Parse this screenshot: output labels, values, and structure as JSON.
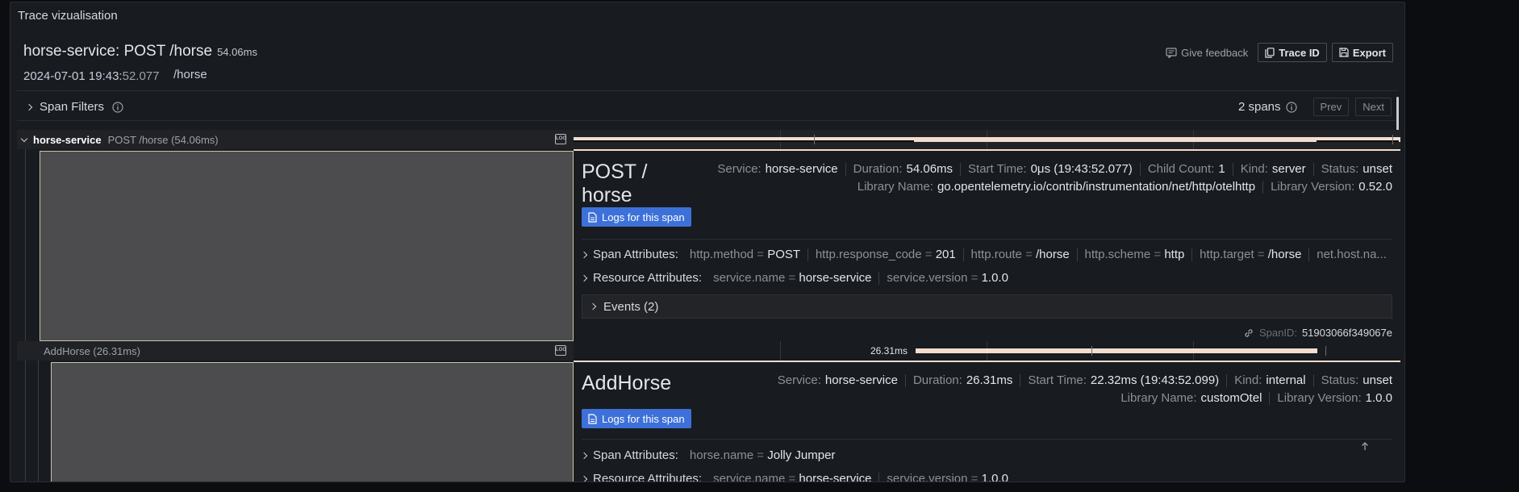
{
  "panel": {
    "title": "Trace vizualisation"
  },
  "header": {
    "service_op": "horse-service: POST /horse",
    "duration": "54.06ms",
    "date_main": "2024-07-01 19:43:",
    "date_sec": "52.077",
    "url": "/horse",
    "feedback_label": "Give feedback",
    "trace_id_label": "Trace ID",
    "export_label": "Export"
  },
  "filters": {
    "label": "Span Filters",
    "spans_count": "2 spans",
    "prev_label": "Prev",
    "next_label": "Next"
  },
  "spans": [
    {
      "service": "horse-service",
      "name_label": "POST /horse (54.06ms)",
      "bar_start": 0,
      "bar_end": 1,
      "detail": {
        "title": "POST / horse",
        "meta1": [
          {
            "k": "Service:",
            "v": "horse-service"
          },
          {
            "k": "Duration:",
            "v": "54.06ms"
          },
          {
            "k": "Start Time:",
            "v": "0μs (19:43:52.077)"
          },
          {
            "k": "Child Count:",
            "v": "1"
          },
          {
            "k": "Kind:",
            "v": "server"
          },
          {
            "k": "Status:",
            "v": "unset"
          }
        ],
        "meta2": [
          {
            "k": "Library Name:",
            "v": "go.opentelemetry.io/contrib/instrumentation/net/http/otelhttp"
          },
          {
            "k": "Library Version:",
            "v": "0.52.0"
          }
        ],
        "logs_label": "Logs for this span",
        "span_attr_label": "Span Attributes:",
        "span_attrs": [
          {
            "k": "http.method",
            "v": "POST"
          },
          {
            "k": "http.response_code",
            "v": "201"
          },
          {
            "k": "http.route",
            "v": "/horse"
          },
          {
            "k": "http.scheme",
            "v": "http"
          },
          {
            "k": "http.target",
            "v": "/horse"
          },
          {
            "k": "net.host.na...",
            "v": ""
          }
        ],
        "resource_attr_label": "Resource Attributes:",
        "resource_attrs": [
          {
            "k": "service.name",
            "v": "horse-service"
          },
          {
            "k": "service.version",
            "v": "1.0.0"
          }
        ],
        "events_label": "Events (2)",
        "span_id_label": "SpanID:",
        "span_id": "51903066f349067e"
      }
    },
    {
      "service": "",
      "name_label": "AddHorse (26.31ms)",
      "bar_label": "26.31ms",
      "bar_start": 0.4133,
      "bar_end": 0.8999,
      "detail": {
        "title": "AddHorse",
        "meta1": [
          {
            "k": "Service:",
            "v": "horse-service"
          },
          {
            "k": "Duration:",
            "v": "26.31ms"
          },
          {
            "k": "Start Time:",
            "v": "22.32ms (19:43:52.099)"
          },
          {
            "k": "Kind:",
            "v": "internal"
          },
          {
            "k": "Status:",
            "v": "unset"
          }
        ],
        "meta2": [
          {
            "k": "Library Name:",
            "v": "customOtel"
          },
          {
            "k": "Library Version:",
            "v": "1.0.0"
          }
        ],
        "logs_label": "Logs for this span",
        "span_attr_label": "Span Attributes:",
        "span_attrs": [
          {
            "k": "horse.name",
            "v": "Jolly Jumper"
          }
        ],
        "resource_attr_label": "Resource Attributes:",
        "resource_attrs": [
          {
            "k": "service.name",
            "v": "horse-service"
          },
          {
            "k": "service.version",
            "v": "1.0.0"
          }
        ]
      }
    }
  ],
  "colors": {
    "bar": "#f2ddcf",
    "accent": "#3d71d9"
  }
}
